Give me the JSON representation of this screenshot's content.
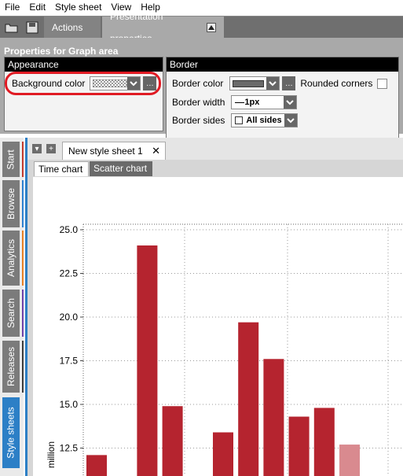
{
  "menu": [
    "File",
    "Edit",
    "Style sheet",
    "View",
    "Help"
  ],
  "ribbon": {
    "actions_tab": "Actions",
    "active_tab": "Presentation properties"
  },
  "properties": {
    "title": "Properties for Graph area",
    "appearance": {
      "header": "Appearance",
      "background_color_label": "Background color"
    },
    "border": {
      "header": "Border",
      "border_color_label": "Border color",
      "rounded_corners_label": "Rounded corners",
      "border_width_label": "Border width",
      "border_width_value": "1px",
      "border_sides_label": "Border sides",
      "border_sides_value": "All sides"
    }
  },
  "vertical_tabs": [
    {
      "label": "Start",
      "color": "#c0392b"
    },
    {
      "label": "Browse",
      "color": "#2b7fd0"
    },
    {
      "label": "Analytics",
      "color": "#e67e22"
    },
    {
      "label": "Search",
      "color": "#6c3fa8"
    },
    {
      "label": "Releases",
      "color": "#3a3a3a"
    },
    {
      "label": "Style sheets",
      "color": "#2c7fc6"
    }
  ],
  "document": {
    "tab_title": "New style sheet 1",
    "subtabs": [
      "Time chart",
      "Scatter chart"
    ]
  },
  "chart_data": {
    "type": "bar",
    "ylabel": "million",
    "ylim": [
      11.5,
      25.5
    ],
    "yticks": [
      "25.0",
      "22.5",
      "20.0",
      "17.5",
      "15.0",
      "12.5"
    ],
    "values": [
      12.1,
      null,
      24.1,
      14.9,
      null,
      13.4,
      19.7,
      17.6,
      14.3,
      14.8,
      12.7
    ],
    "colors": [
      "#b5242f",
      null,
      "#b5242f",
      "#b5242f",
      null,
      "#b5242f",
      "#b5242f",
      "#b5242f",
      "#b5242f",
      "#b5242f",
      "#d98a8f"
    ]
  }
}
